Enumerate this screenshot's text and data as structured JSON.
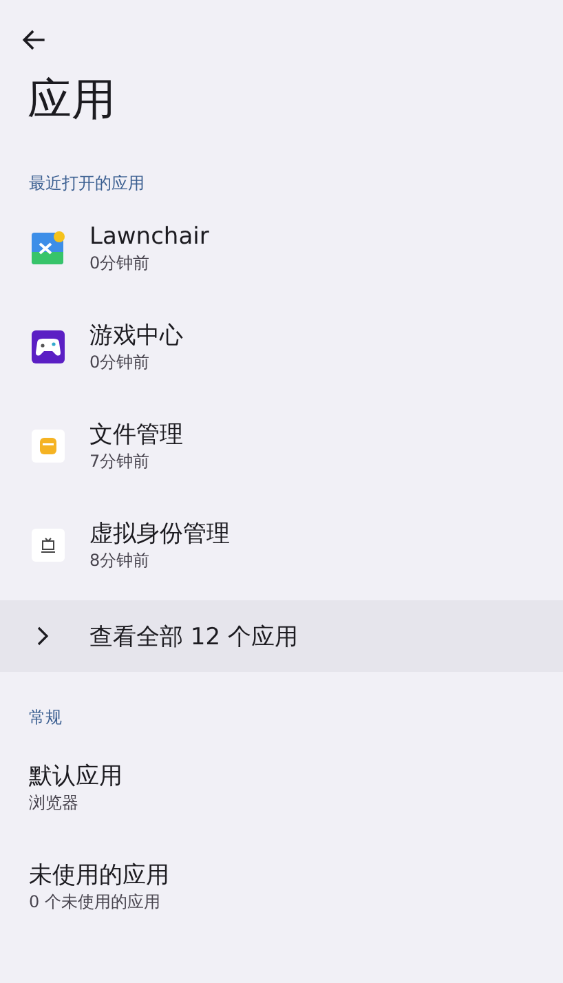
{
  "title": "应用",
  "recent": {
    "header": "最近打开的应用",
    "apps": [
      {
        "name": "Lawnchair",
        "time": "0分钟前"
      },
      {
        "name": "游戏中心",
        "time": "0分钟前"
      },
      {
        "name": "文件管理",
        "time": "7分钟前"
      },
      {
        "name": "虚拟身份管理",
        "time": "8分钟前"
      }
    ],
    "see_all": "查看全部 12 个应用"
  },
  "general": {
    "header": "常规",
    "items": [
      {
        "title": "默认应用",
        "subtitle": "浏览器"
      },
      {
        "title": "未使用的应用",
        "subtitle": "0 个未使用的应用"
      }
    ]
  }
}
